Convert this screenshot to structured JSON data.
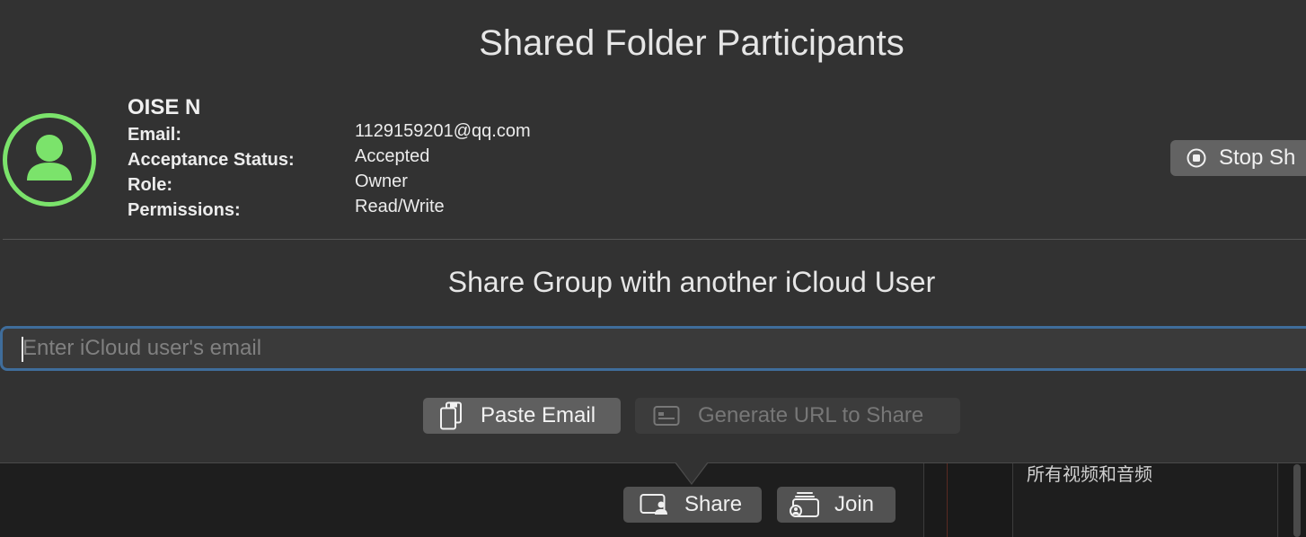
{
  "dialog": {
    "title": "Shared Folder Participants",
    "subtitle": "Share Group with another iCloud User"
  },
  "participant": {
    "avatar_icon": "person-circle-icon",
    "avatar_color": "#7be36b",
    "name": "OISE N",
    "fields": {
      "email": {
        "label": "Email:",
        "value": "1129159201@qq.com"
      },
      "status": {
        "label": "Acceptance Status:",
        "value": "Accepted"
      },
      "role": {
        "label": "Role:",
        "value": "Owner"
      },
      "permissions": {
        "label": "Permissions:",
        "value": "Read/Write"
      }
    }
  },
  "stop_button": {
    "label": "Stop Sh",
    "icon": "stop-circle-icon"
  },
  "email_input": {
    "placeholder": "Enter iCloud user's email",
    "value": "",
    "focus_color": "#3f6d9b"
  },
  "actions": {
    "paste": {
      "label": "Paste Email",
      "icon": "clipboard-icon"
    },
    "generate": {
      "label": "Generate URL to Share",
      "icon": "url-card-icon",
      "enabled": false
    }
  },
  "toolbar": {
    "share": {
      "label": "Share",
      "icon": "share-person-icon"
    },
    "join": {
      "label": "Join",
      "icon": "join-stack-icon"
    }
  },
  "side_panel": {
    "label": "所有视频和音频"
  }
}
